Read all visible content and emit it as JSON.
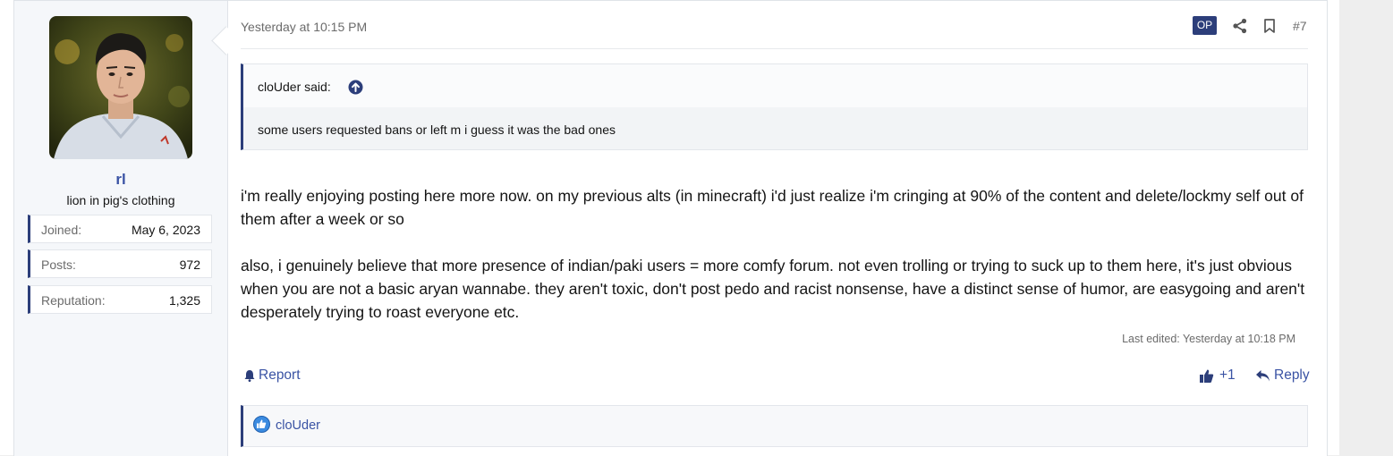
{
  "user": {
    "username": "rl",
    "title": "lion in pig's clothing",
    "stats": [
      {
        "label": "Joined:",
        "value": "May 6, 2023"
      },
      {
        "label": "Posts:",
        "value": "972"
      },
      {
        "label": "Reputation:",
        "value": "1,325"
      }
    ]
  },
  "post": {
    "timestamp": "Yesterday at 10:15 PM",
    "op_badge": "OP",
    "number": "#7",
    "quote": {
      "author": "cloUder said:",
      "text": "some users requested bans or left m i guess it was the bad ones"
    },
    "paragraphs": [
      "i'm really enjoying posting here more now. on my previous alts (in minecraft) i'd just realize i'm cringing at 90% of the content and delete/lockmy self out of them after a week or so",
      "also, i genuinely believe that more presence of indian/paki users = more comfy forum. not even trolling or trying to suck up to them here, it's just obvious when you are not a basic aryan wannabe. they aren't toxic, don't post pedo and racist nonsense, have a distinct sense of humor, are easygoing and aren't desperately trying to roast everyone etc."
    ],
    "last_edited": "Last edited: Yesterday at 10:18 PM",
    "actions": {
      "report": "Report",
      "like_count": "+1",
      "reply": "Reply"
    },
    "reactions": {
      "users": "cloUder"
    }
  },
  "colors": {
    "accent": "#2c3e7a",
    "link": "#3a53a4"
  }
}
